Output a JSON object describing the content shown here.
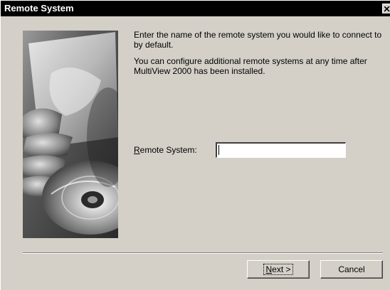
{
  "window": {
    "title": "Remote System"
  },
  "content": {
    "paragraph1": "Enter the name of the remote system you would like to connect to by default.",
    "paragraph2": "You can configure additional remote systems at any time after MultiView 2000 has been installed."
  },
  "form": {
    "label_accel": "R",
    "label_rest": "emote System:",
    "value": ""
  },
  "buttons": {
    "next_accel": "N",
    "next_rest": "ext >",
    "cancel": "Cancel"
  },
  "colors": {
    "titlebar": "#000000",
    "face": "#d4d0c8",
    "shadow": "#808080",
    "highlight": "#ffffff"
  },
  "icons": {
    "close": "close-icon",
    "side_graphic": "cd-disc-graphic"
  }
}
